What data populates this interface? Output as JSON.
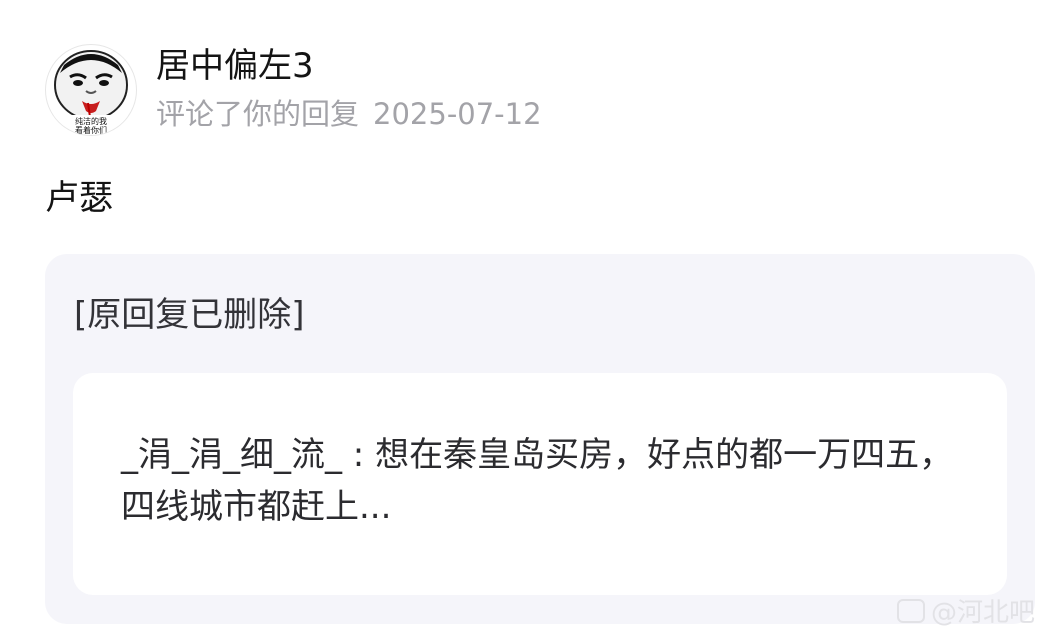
{
  "notification": {
    "username": "居中偏左3",
    "action": "评论了你的回复",
    "date": "2025-07-12",
    "comment": "卢瑟"
  },
  "quote": {
    "deleted_note": "[原回复已删除]",
    "original_post": "_涓_涓_细_流_ : 想在秦皇岛买房，好点的都一万四五，四线城市都赶上..."
  },
  "avatar": {
    "caption_line1": "纯洁的我",
    "caption_line2": "看着你们"
  },
  "watermark": {
    "text": "@河北吧"
  },
  "colors": {
    "card_background": "#f5f5fa",
    "inner_card_background": "#ffffff",
    "meta_text": "#a3a3a8",
    "primary_text": "#141414"
  }
}
